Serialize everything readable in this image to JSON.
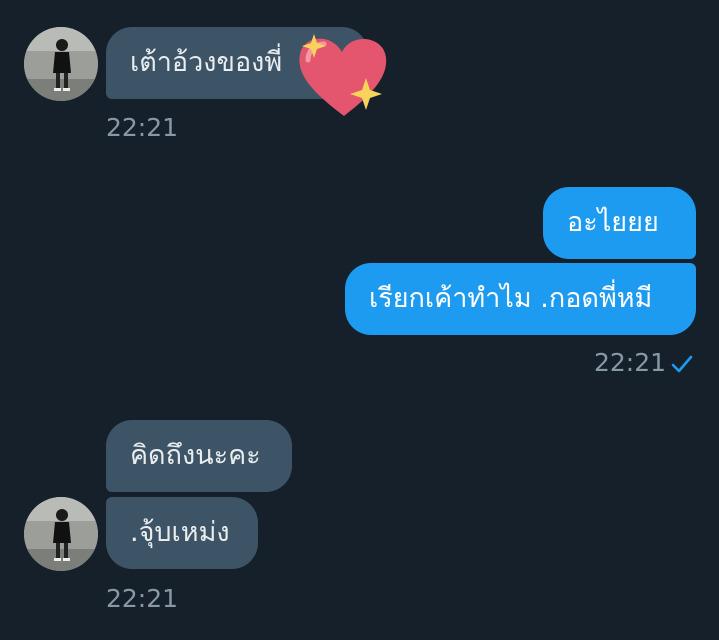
{
  "conversation": {
    "incoming_group_1": {
      "messages": [
        "เต้าอ้วงของพี่"
      ],
      "timestamp": "22:21",
      "sticker": "sparkling-heart-icon"
    },
    "outgoing_group": {
      "messages": [
        "อะไยยย",
        "เรียกเค้าทำไม .กอดพี่หมี"
      ],
      "timestamp": "22:21",
      "status_icon": "sent-check-icon"
    },
    "incoming_group_2": {
      "messages": [
        "คิดถึงนะคะ",
        ".จุ้บเหม่ง"
      ],
      "timestamp": "22:21"
    }
  },
  "colors": {
    "background": "#15202b",
    "incoming_bubble": "#3d5466",
    "outgoing_bubble": "#1d9bf0",
    "timestamp": "#8899a6",
    "heart": "#e4566d",
    "sparkle": "#f7d35c"
  }
}
